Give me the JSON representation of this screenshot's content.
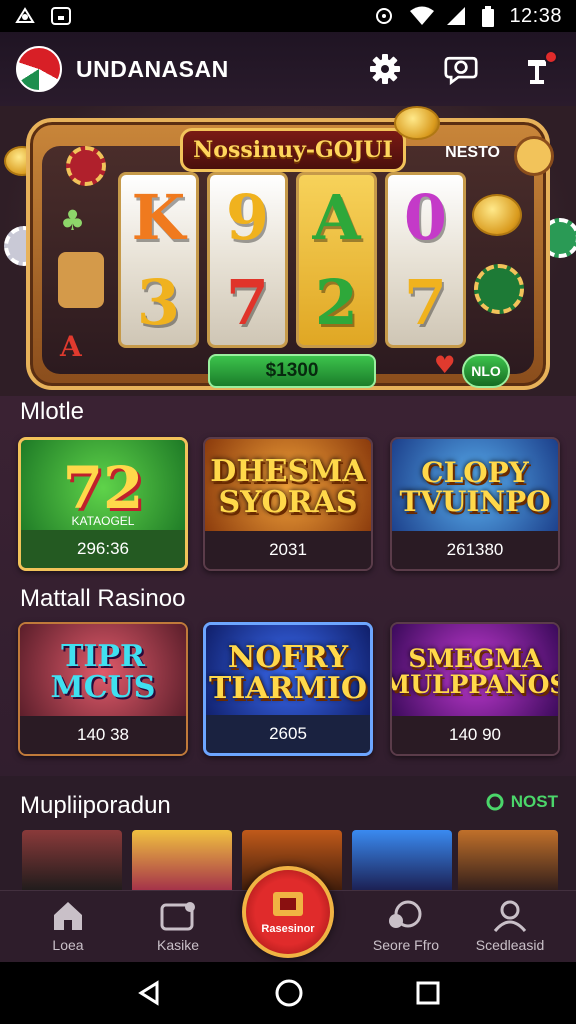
{
  "status_bar": {
    "time": "12:38",
    "icons": [
      "camera-icon",
      "notification-icon",
      "wifi-icon",
      "signal-icon",
      "battery-icon"
    ]
  },
  "app": {
    "title": "UNDANASAN",
    "accent": "#f2c35a",
    "actions": [
      "gear-icon",
      "chat-icon",
      "trophy-icon"
    ]
  },
  "hero": {
    "marquee": "Nossinuy-GOJUI",
    "corner_label": "NESTO",
    "reels": [
      [
        "K",
        "3"
      ],
      [
        "9",
        "7"
      ],
      [
        "A",
        "2"
      ],
      [
        "0",
        "7"
      ]
    ],
    "credit": "$1300",
    "mini_button": "NLO"
  },
  "sections": [
    {
      "title": "Mlotle",
      "cards": [
        {
          "art": "72",
          "sub": "KATAOGEL",
          "num": "296:36",
          "theme": "green"
        },
        {
          "art": "DHESMA SYORAS",
          "sub": "",
          "num": "2031",
          "theme": "orange"
        },
        {
          "art": "CLOPY TVUINPO",
          "sub": "",
          "num": "261380",
          "theme": "blue"
        }
      ]
    },
    {
      "title": "Mattall Rasinoo",
      "cards": [
        {
          "art": "TIPR MCUS",
          "sub": "",
          "num": "140 38",
          "theme": "warm"
        },
        {
          "art": "NOFRY TIARMIO",
          "sub": "",
          "num": "2605",
          "theme": "navy"
        },
        {
          "art": "SMEGMA MULPPANOS",
          "sub": "",
          "num": "140 90",
          "theme": "purple"
        }
      ]
    }
  ],
  "multiplayer": {
    "title": "Mupliiporadun",
    "see_more": "NOST"
  },
  "bottom_nav": {
    "items": [
      {
        "label": "Loea",
        "icon": "home-icon"
      },
      {
        "label": "Kasike",
        "icon": "wallet-icon"
      },
      {
        "label": "Rasesinor",
        "icon": "casino-icon"
      },
      {
        "label": "Seore Ffro",
        "icon": "chat-icon"
      },
      {
        "label": "Scedleasid",
        "icon": "profile-icon"
      }
    ]
  },
  "system_nav": [
    "back-icon",
    "home-icon",
    "recents-icon"
  ]
}
